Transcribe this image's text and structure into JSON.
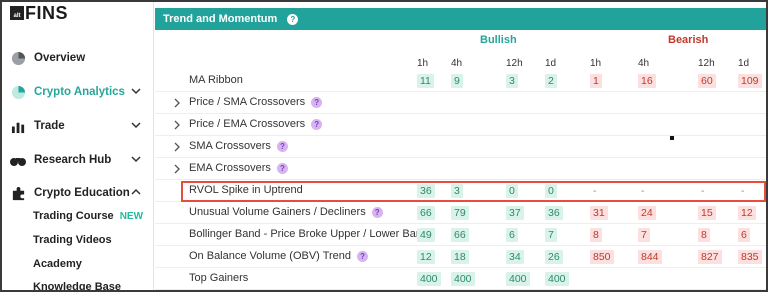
{
  "sidebar": {
    "logo_text": "FINS",
    "logo_prefix": "alt",
    "items": [
      {
        "label": "Overview"
      },
      {
        "label": "Crypto Analytics"
      },
      {
        "label": "Trade"
      },
      {
        "label": "Research Hub"
      },
      {
        "label": "Crypto Education"
      }
    ],
    "sub_items": [
      {
        "label": "Trading Course",
        "badge": "NEW"
      },
      {
        "label": "Trading Videos"
      },
      {
        "label": "Academy"
      },
      {
        "label": "Knowledge Base"
      }
    ],
    "accent_color": "#26a69a"
  },
  "section": {
    "title": "Trend and Momentum",
    "help": "?",
    "bar_color": "#21a39b"
  },
  "groups": {
    "bullish": "Bullish",
    "bearish": "Bearish"
  },
  "columns": [
    "1h",
    "4h",
    "12h",
    "1d",
    "1h",
    "4h",
    "12h",
    "1d"
  ],
  "rows": [
    {
      "label": "MA Ribbon",
      "expandable": false,
      "help": false,
      "bull": [
        "11",
        "9",
        "3",
        "2"
      ],
      "bear": [
        "1",
        "16",
        "60",
        "109"
      ]
    },
    {
      "label": "Price / SMA Crossovers",
      "expandable": true,
      "help": true,
      "bull": [],
      "bear": []
    },
    {
      "label": "Price / EMA Crossovers",
      "expandable": true,
      "help": true,
      "bull": [],
      "bear": []
    },
    {
      "label": "SMA Crossovers",
      "expandable": true,
      "help": true,
      "bull": [],
      "bear": []
    },
    {
      "label": "EMA Crossovers",
      "expandable": true,
      "help": true,
      "bull": [],
      "bear": []
    },
    {
      "label": "RVOL Spike in Uptrend",
      "expandable": false,
      "help": false,
      "bull": [
        "36",
        "3",
        "0",
        "0"
      ],
      "bear": [
        "-",
        "-",
        "-",
        "-"
      ]
    },
    {
      "label": "Unusual Volume Gainers / Decliners",
      "expandable": false,
      "help": true,
      "bull": [
        "66",
        "79",
        "37",
        "36"
      ],
      "bear": [
        "31",
        "24",
        "15",
        "12"
      ]
    },
    {
      "label": "Bollinger Band - Price Broke Upper / Lower Band",
      "expandable": false,
      "help": false,
      "bull": [
        "49",
        "66",
        "6",
        "7"
      ],
      "bear": [
        "8",
        "7",
        "8",
        "6"
      ]
    },
    {
      "label": "On Balance Volume (OBV) Trend",
      "expandable": false,
      "help": true,
      "bull": [
        "12",
        "18",
        "34",
        "26"
      ],
      "bear": [
        "850",
        "844",
        "827",
        "835"
      ]
    },
    {
      "label": "Top Gainers",
      "expandable": false,
      "help": false,
      "bull": [
        "400",
        "400",
        "400",
        "400"
      ],
      "bear": []
    }
  ],
  "colors": {
    "bullish": "#2e8b66",
    "bearish": "#c0392b",
    "highlight": "#e74c3c"
  }
}
